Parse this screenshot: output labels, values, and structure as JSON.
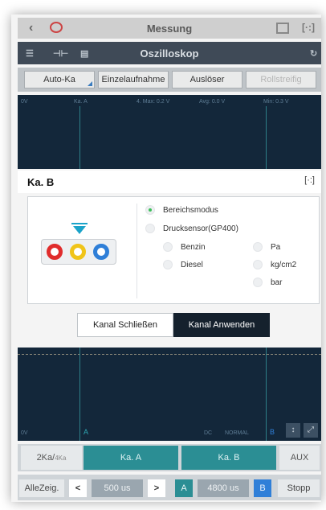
{
  "titlebar": {
    "title": "Messung"
  },
  "oscbar": {
    "title": "Oszilloskop"
  },
  "toolbar": {
    "auto_label": "Auto-Ka",
    "single_label": "Einzelaufnahme",
    "trigger_label": "Auslöser",
    "roll_label": "Rollstreifig"
  },
  "scope_top": {
    "ch_a": "Ka. A",
    "max": "4. Max: 0.2 V",
    "avg": "Avg: 0.0 V",
    "min": "Min: 0.3 V",
    "left": "0V"
  },
  "channel": {
    "name": "Ka. B"
  },
  "options": {
    "range_mode": "Bereichsmodus",
    "pressure_sensor": "Drucksensor(GP400)",
    "benzin": "Benzin",
    "diesel": "Diesel",
    "pa": "Pa",
    "kgcm2": "kg/cm2",
    "bar": "bar"
  },
  "buttons": {
    "close": "Kanal Schließen",
    "apply": "Kanal Anwenden"
  },
  "scope_bottom": {
    "left": "0V",
    "a": "A",
    "dc": "DC",
    "normal": "NORMAL",
    "b": "B"
  },
  "chanbar": {
    "two": "2Ka/",
    "two_sub": "4Ka",
    "ka_a": "Ka. A",
    "ka_b": "Ka. B",
    "aux": "AUX"
  },
  "ctrlbar": {
    "all": "AlleZeig.",
    "prev": "<",
    "time": "500 us",
    "next": ">",
    "a": "A",
    "pos": "4800 us",
    "b": "B",
    "stop": "Stopp"
  },
  "colors": {
    "accent": "#1aa3c9",
    "teal_button": "#2b8e94",
    "dark": "#15212d",
    "radio_on": "#3cbf59"
  }
}
